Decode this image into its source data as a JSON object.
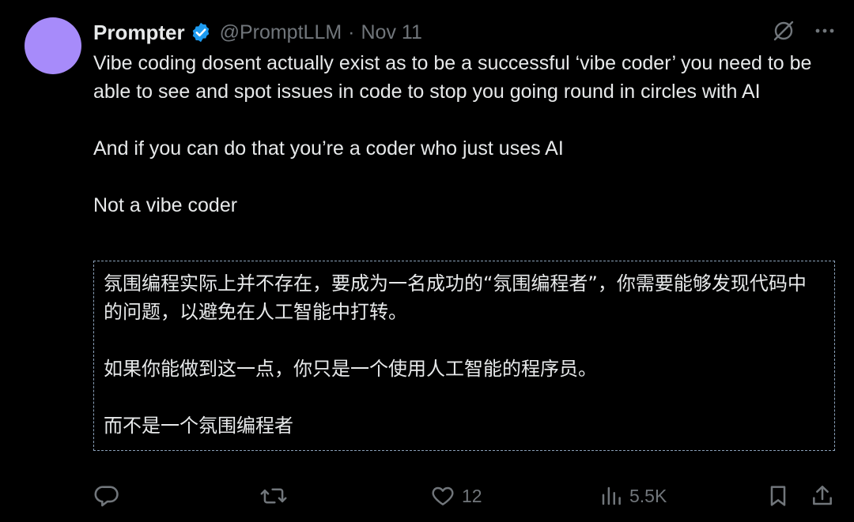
{
  "author": {
    "name": "Prompter",
    "handle": "@PromptLLM",
    "separator": "·",
    "date": "Nov 11",
    "avatar_color": "#a78bfa",
    "verified_color": "#1d9bf0"
  },
  "top_actions": {
    "icons": [
      "grok-icon",
      "more-icon"
    ]
  },
  "tweet": {
    "paragraphs": [
      "Vibe coding dosent actually exist as to be a successful ‘vibe coder’ you need to be able to see and spot issues in code to stop you going round in circles with AI",
      "And if you can do that you’re a coder who just uses AI",
      "Not a vibe coder"
    ]
  },
  "translation": {
    "paragraphs": [
      "氛围编程实际上并不存在，要成为一名成功的“氛围编程者”，你需要能够发现代码中的问题，以避免在人工智能中打转。",
      "如果你能做到这一点，你只是一个使用人工智能的程序员。",
      "而不是一个氛围编程者"
    ],
    "border_color": "#8aa0b8"
  },
  "actions": {
    "reply_count": "",
    "repost_count": "",
    "like_count": "12",
    "views_count": "5.5K",
    "icon_color": "#71767b"
  }
}
